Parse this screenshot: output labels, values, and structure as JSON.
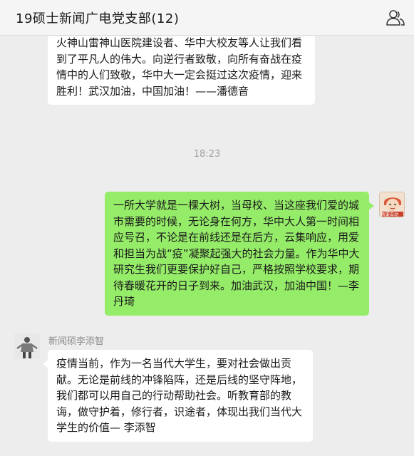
{
  "header": {
    "title": "19硕士新闻广电党支部(12)",
    "members_icon": "members-icon"
  },
  "messages": [
    {
      "direction": "incoming",
      "text": "火神山雷神山医院建设者、华中大校友等人让我们看到了平凡人的伟大。向逆行者致敬，向所有奋战在疫情中的人们致敬，华中大一定会挺过这次疫情，迎来胜利！武汉加油，中国加油！——潘德音"
    },
    {
      "type": "timestamp",
      "text": "18:23"
    },
    {
      "direction": "outgoing",
      "avatar_caption": "我要去动",
      "text": "一所大学就是一棵大树，当母校、当这座我们爱的城市需要的时候，无论身在何方，华中大人第一时间相应号召，不论是在前线还是在后方，云集响应，用爱和担当为战“疫”凝聚起强大的社会力量。作为华中大研究生我们更要保护好自己，严格按照学校要求，期待春暖花开的日子到来。加油武汉，加油中国！—李丹琦"
    },
    {
      "direction": "incoming",
      "sender": "新闻硕李添智",
      "text": "疫情当前，作为一名当代大学生，要对社会做出贡献。无论是前线的冲锋陷阵，还是后线的坚守阵地，我们都可以用自己的行动帮助社会。听教育部的教诲，做守护着，修行者，识途者，体现出我们当代大学生的价值— 李添智"
    }
  ],
  "colors": {
    "outgoing_bubble": "#95ec69",
    "incoming_bubble": "#ffffff",
    "background": "#ededed"
  }
}
